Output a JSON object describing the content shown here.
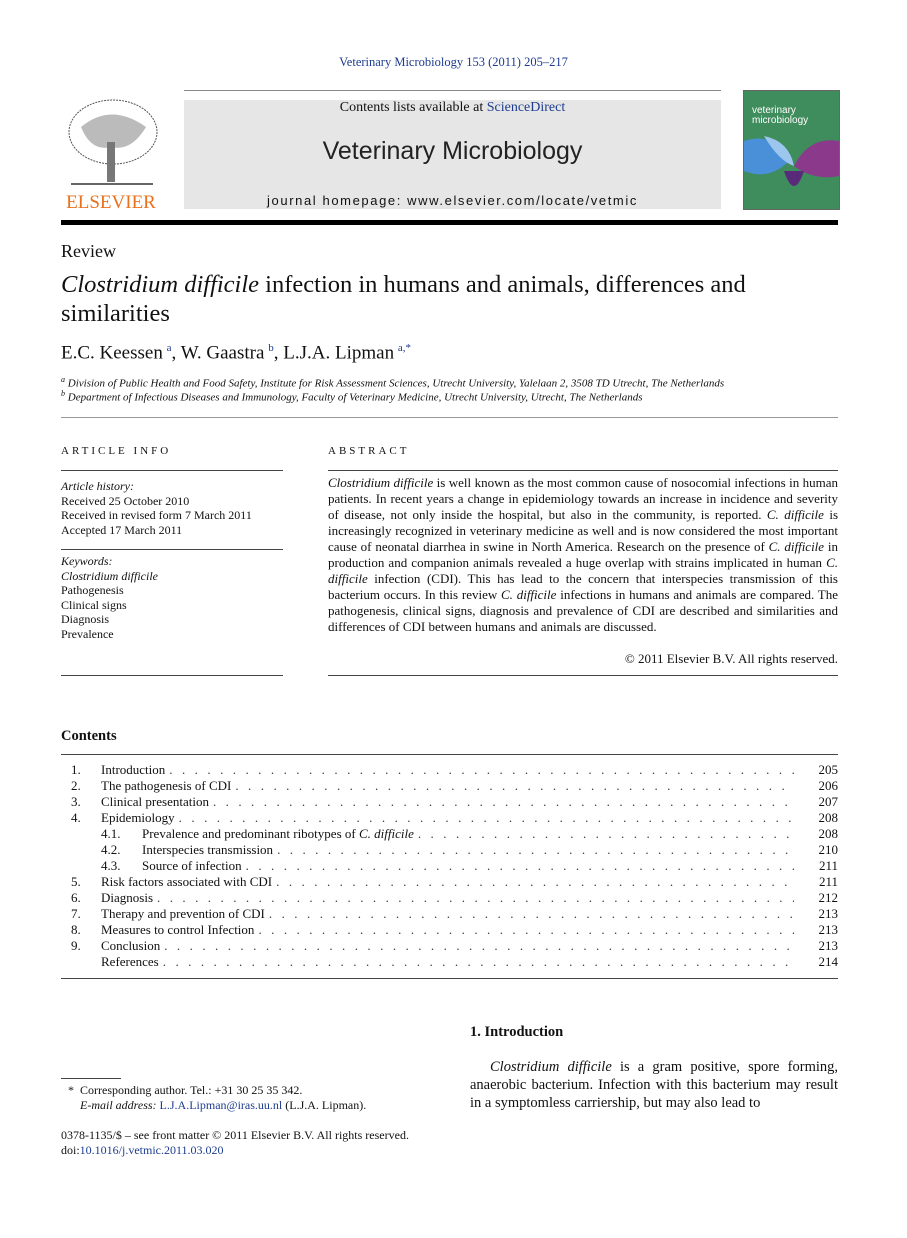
{
  "header": {
    "citation": "Veterinary Microbiology 153 (2011) 205–217",
    "contents_prefix": "Contents lists available at ",
    "sciencedirect": "ScienceDirect",
    "journal_title": "Veterinary Microbiology",
    "homepage_prefix": "journal homepage: ",
    "homepage_url": "www.elsevier.com/locate/vetmic",
    "publisher_logo": "ELSEVIER",
    "cover_title": "veterinary microbiology"
  },
  "article": {
    "type": "Review",
    "title_italic": "Clostridium difficile",
    "title_rest": " infection in humans and animals, differences and similarities",
    "authors": [
      {
        "name": "E.C. Keessen",
        "sup": "a"
      },
      {
        "name": "W. Gaastra",
        "sup": "b"
      },
      {
        "name": "L.J.A. Lipman",
        "sup": "a,*"
      }
    ],
    "affiliations": [
      {
        "sup": "a",
        "text": "Division of Public Health and Food Safety, Institute for Risk Assessment Sciences, Utrecht University, Yalelaan 2, 3508 TD Utrecht, The Netherlands"
      },
      {
        "sup": "b",
        "text": "Department of Infectious Diseases and Immunology, Faculty of Veterinary Medicine, Utrecht University, Utrecht, The Netherlands"
      }
    ]
  },
  "article_info": {
    "heading": "ARTICLE INFO",
    "history_label": "Article history:",
    "history": [
      "Received 25 October 2010",
      "Received in revised form 7 March 2011",
      "Accepted 17 March 2011"
    ],
    "keywords_label": "Keywords:",
    "keywords": [
      {
        "t": "Clostridium difficile",
        "i": true
      },
      {
        "t": "Pathogenesis"
      },
      {
        "t": "Clinical signs"
      },
      {
        "t": "Diagnosis"
      },
      {
        "t": "Prevalence"
      }
    ]
  },
  "abstract": {
    "heading": "ABSTRACT",
    "segments": [
      {
        "t": "Clostridium difficile",
        "i": true
      },
      {
        "t": " is well known as the most common cause of nosocomial infections in human patients. In recent years a change in epidemiology towards an increase in incidence and severity of disease, not only inside the hospital, but also in the community, is reported. "
      },
      {
        "t": "C. difficile",
        "i": true
      },
      {
        "t": " is increasingly recognized in veterinary medicine as well and is now considered the most important cause of neonatal diarrhea in swine in North America. Research on the presence of "
      },
      {
        "t": "C. difficile",
        "i": true
      },
      {
        "t": " in production and companion animals revealed a huge overlap with strains implicated in human "
      },
      {
        "t": "C. difficile",
        "i": true
      },
      {
        "t": " infection (CDI). This has lead to the concern that interspecies transmission of this bacterium occurs. In this review "
      },
      {
        "t": "C. difficile",
        "i": true
      },
      {
        "t": " infections in humans and animals are compared. The pathogenesis, clinical signs, diagnosis and prevalence of CDI are described and similarities and differences of CDI between humans and animals are discussed."
      }
    ],
    "copyright": "© 2011 Elsevier B.V. All rights reserved."
  },
  "contents": {
    "heading": "Contents",
    "items": [
      {
        "num": "1.",
        "title": "Introduction",
        "page": "205"
      },
      {
        "num": "2.",
        "title": "The pathogenesis of CDI",
        "page": "206"
      },
      {
        "num": "3.",
        "title": "Clinical presentation",
        "page": "207"
      },
      {
        "num": "4.",
        "title": "Epidemiology",
        "page": "208"
      },
      {
        "num": "4.1.",
        "title": "Prevalence and predominant ribotypes of ",
        "title_italic": "C. difficile",
        "page": "208",
        "sub": true
      },
      {
        "num": "4.2.",
        "title": "Interspecies transmission",
        "page": "210",
        "sub": true
      },
      {
        "num": "4.3.",
        "title": "Source of infection",
        "page": "211",
        "sub": true
      },
      {
        "num": "5.",
        "title": "Risk factors associated with CDI",
        "page": "211"
      },
      {
        "num": "6.",
        "title": "Diagnosis",
        "page": "212"
      },
      {
        "num": "7.",
        "title": "Therapy and prevention of CDI",
        "page": "213"
      },
      {
        "num": "8.",
        "title": "Measures to control Infection",
        "page": "213"
      },
      {
        "num": "9.",
        "title": "Conclusion",
        "page": "213"
      },
      {
        "num": "",
        "title": "References",
        "page": "214"
      }
    ]
  },
  "introduction": {
    "heading": "1.  Introduction",
    "italic": "Clostridium difficile",
    "text": " is a gram positive, spore forming, anaerobic bacterium. Infection with this bacterium may result in a symptomless carriership, but may also lead to"
  },
  "footnotes": {
    "star": "*",
    "corresponding": "Corresponding author. Tel.: +31 30 25 35 342.",
    "email_label": "E-mail address: ",
    "email": "L.J.A.Lipman@iras.uu.nl",
    "email_suffix": " (L.J.A. Lipman).",
    "front_matter": "0378-1135/$ – see front matter © 2011 Elsevier B.V. All rights reserved.",
    "doi_prefix": "doi:",
    "doi": "10.1016/j.vetmic.2011.03.020"
  }
}
